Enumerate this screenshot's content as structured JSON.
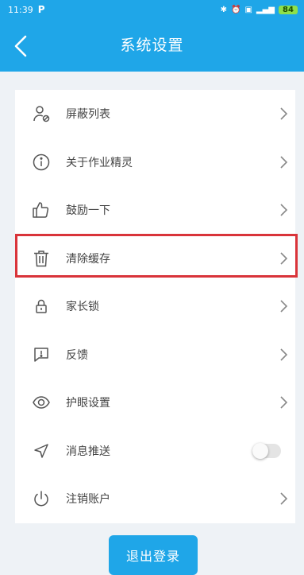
{
  "status_bar": {
    "time": "11:39",
    "app_indicator": "P",
    "battery_level": "84"
  },
  "header": {
    "title": "系统设置"
  },
  "settings": {
    "items": [
      {
        "label": "屏蔽列表",
        "icon": "person-block-icon"
      },
      {
        "label": "关于作业精灵",
        "icon": "info-icon"
      },
      {
        "label": "鼓励一下",
        "icon": "thumbs-up-icon"
      },
      {
        "label": "清除缓存",
        "icon": "trash-icon"
      },
      {
        "label": "家长锁",
        "icon": "lock-icon"
      },
      {
        "label": "反馈",
        "icon": "feedback-icon"
      },
      {
        "label": "护眼设置",
        "icon": "eye-icon"
      },
      {
        "label": "消息推送",
        "icon": "send-icon",
        "toggle": false
      },
      {
        "label": "注销账户",
        "icon": "power-icon"
      }
    ]
  },
  "logout": {
    "label": "退出登录"
  },
  "colors": {
    "primary": "#1fa6e8",
    "highlight": "#d9343a",
    "background": "#eef2f6"
  }
}
